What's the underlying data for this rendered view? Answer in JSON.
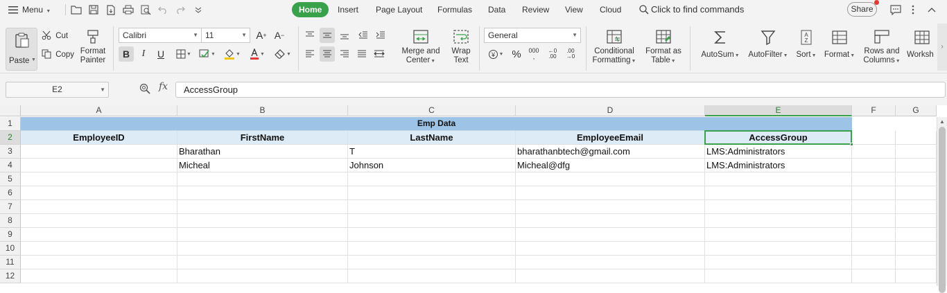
{
  "menubar": {
    "menu_label": "Menu",
    "tabs": [
      {
        "label": "Home",
        "active": true
      },
      {
        "label": "Insert",
        "active": false
      },
      {
        "label": "Page Layout",
        "active": false
      },
      {
        "label": "Formulas",
        "active": false
      },
      {
        "label": "Data",
        "active": false
      },
      {
        "label": "Review",
        "active": false
      },
      {
        "label": "View",
        "active": false
      },
      {
        "label": "Cloud",
        "active": false
      }
    ],
    "search_commands": "Click to find commands",
    "share_label": "Share",
    "accent_color": "#3aa14b"
  },
  "ribbon": {
    "paste": "Paste",
    "cut": "Cut",
    "copy": "Copy",
    "format_painter_1": "Format",
    "format_painter_2": "Painter",
    "font_name": "Calibri",
    "font_size": "11",
    "bold": "B",
    "italic": "I",
    "underline": "U",
    "merge_center_1": "Merge and",
    "merge_center_2": "Center",
    "wrap_text_1": "Wrap",
    "wrap_text_2": "Text",
    "number_format": "General",
    "percent": "%",
    "thousands": "000",
    "conditional_formatting_1": "Conditional",
    "conditional_formatting_2": "Formatting",
    "format_as_table_1": "Format as",
    "format_as_table_2": "Table",
    "autosum": "AutoSum",
    "autofilter": "AutoFilter",
    "sort": "Sort",
    "format": "Format",
    "rows_columns_1": "Rows and",
    "rows_columns_2": "Columns",
    "worksheet": "Worksh"
  },
  "formula_bar": {
    "name_box": "E2",
    "fx": "fx",
    "content": "AccessGroup"
  },
  "sheet": {
    "columns": [
      "A",
      "B",
      "C",
      "D",
      "E",
      "F",
      "G"
    ],
    "rows": [
      "1",
      "2",
      "3",
      "4",
      "5",
      "6",
      "7",
      "8",
      "9",
      "10",
      "11",
      "12"
    ],
    "title": "Emp Data",
    "headers": [
      "EmployeeID",
      "FirstName",
      "LastName",
      "EmployeeEmail",
      "AccessGroup"
    ],
    "data": [
      [
        "",
        "Bharathan",
        "T",
        "bharathanbtech@gmail.com",
        "LMS:Administrators"
      ],
      [
        "",
        "Micheal",
        "Johnson",
        "Micheal@dfg",
        "LMS:Administrators"
      ]
    ],
    "title_fill": "#9dc3e6",
    "header_fill": "#ddebf7",
    "active_cell": "E2"
  }
}
